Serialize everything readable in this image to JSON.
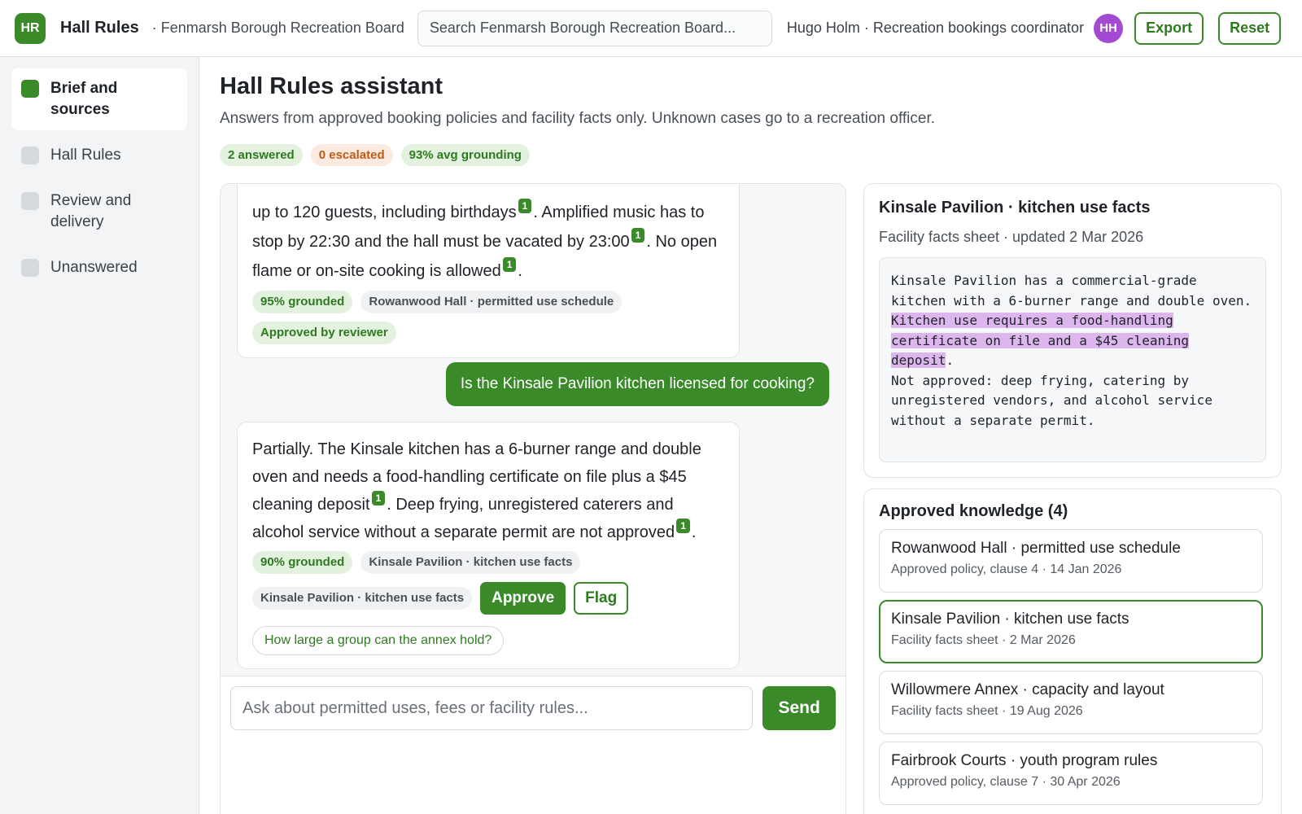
{
  "header": {
    "logo_initials": "HR",
    "app_title": "Hall Rules",
    "org_name": "· Fenmarsh Borough Recreation Board",
    "search_placeholder": "Search Fenmarsh Borough Recreation Board...",
    "user_label": "Hugo Holm · Recreation bookings coordinator",
    "avatar_initials": "HH",
    "export_label": "Export",
    "reset_label": "Reset"
  },
  "sidebar": {
    "items": [
      {
        "label": "Brief and sources",
        "active": true
      },
      {
        "label": "Hall Rules",
        "active": false
      },
      {
        "label": "Review and delivery",
        "active": false
      },
      {
        "label": "Unanswered",
        "active": false
      }
    ]
  },
  "main": {
    "title": "Hall Rules assistant",
    "subtitle": "Answers from approved booking policies and facility facts only. Unknown cases go to a recreation officer.",
    "badges": {
      "answered": "2 answered",
      "escalated": "0 escalated",
      "grounding": "93% avg grounding"
    }
  },
  "chat": {
    "msg1": {
      "part1": "up to 120 guests, including birthdays",
      "part2": ". Amplified music has to stop by 22:30 and the hall must be vacated by 23:00",
      "part3": ". No open flame or on-site cooking is allowed",
      "part4": ".",
      "cite": "1",
      "grounded": "95% grounded",
      "source": "Rowanwood Hall · permitted use schedule",
      "status": "Approved by reviewer"
    },
    "user_question": "Is the Kinsale Pavilion kitchen licensed for cooking?",
    "msg2": {
      "part1": "Partially. The Kinsale kitchen has a 6-burner range and double oven and needs a food-handling certificate on file plus a $45 cleaning deposit",
      "part2": ". Deep frying, unregistered caterers and alcohol service without a separate permit are not approved",
      "part3": ".",
      "cite": "1",
      "grounded": "90% grounded",
      "source_a": "Kinsale Pavilion · kitchen use facts",
      "source_b": "Kinsale Pavilion · kitchen use facts",
      "approve_label": "Approve",
      "flag_label": "Flag",
      "suggestion": "How large a group can the annex hold?"
    },
    "composer_placeholder": "Ask about permitted uses, fees or facility rules...",
    "send_label": "Send"
  },
  "source_panel": {
    "title": "Kinsale Pavilion · kitchen use facts",
    "meta": "Facility facts sheet · updated 2 Mar 2026",
    "text_before": "Kinsale Pavilion has a commercial-grade kitchen with a 6-burner range and double oven.",
    "text_highlight": "Kitchen use requires a food-handling certificate on file and a $45 cleaning deposit",
    "text_after_dot": ".",
    "text_after": "Not approved: deep frying, catering by unregistered vendors, and alcohol service without a separate permit."
  },
  "knowledge": {
    "title": "Approved knowledge (4)",
    "items": [
      {
        "name": "Rowanwood Hall · permitted use schedule",
        "meta": "Approved policy, clause 4 · 14 Jan 2026"
      },
      {
        "name": "Kinsale Pavilion · kitchen use facts",
        "meta": "Facility facts sheet · 2 Mar 2026"
      },
      {
        "name": "Willowmere Annex · capacity and layout",
        "meta": "Facility facts sheet · 19 Aug 2026"
      },
      {
        "name": "Fairbrook Courts · youth program rules",
        "meta": "Approved policy, clause 7 · 30 Apr 2026"
      }
    ]
  },
  "colors": {
    "accent": "#3b8a2a",
    "avatar": "#a24bd2",
    "highlight": "#dcb6ec"
  }
}
